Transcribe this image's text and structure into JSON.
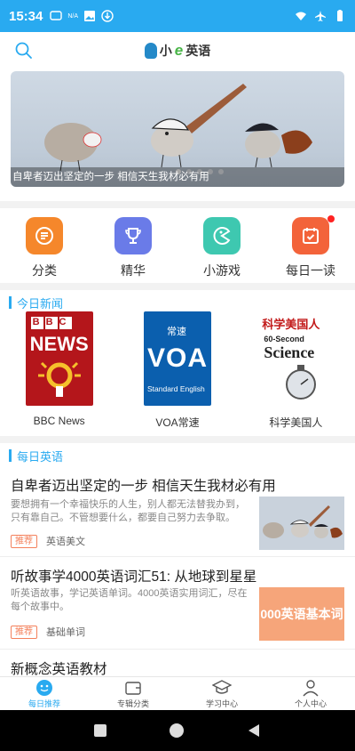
{
  "status_bar": {
    "time": "15:34",
    "na_label": "N/A"
  },
  "app": {
    "logo_text_1": "小",
    "logo_text_e": "e",
    "logo_text_2": "英语"
  },
  "banner": {
    "caption": "自卑者迈出坚定的一步 相信天生我材必有用",
    "slide_count": 5,
    "active_index": 0
  },
  "quick_menu": [
    {
      "label": "分类",
      "color": "#f5872b"
    },
    {
      "label": "精华",
      "color": "#6a7be8"
    },
    {
      "label": "小游戏",
      "color": "#3ec8b0"
    },
    {
      "label": "每日一读",
      "color": "#f3633a"
    }
  ],
  "news_section": {
    "title": "今日新闻",
    "items": [
      {
        "name": "BBC News",
        "cover_line1": "BBC",
        "cover_line2": "NEWS"
      },
      {
        "name": "VOA常速",
        "cover_top": "常速",
        "cover_main": "VOA",
        "cover_sub": "Standard English"
      },
      {
        "name": "科学美国人",
        "cover_top": "科学美国人",
        "cover_line1": "60-Second",
        "cover_line2": "Science"
      }
    ]
  },
  "daily_section": {
    "title": "每日英语",
    "articles": [
      {
        "title": "自卑者迈出坚定的一步 相信天生我材必有用",
        "desc": "要想拥有一个幸福快乐的人生，别人都无法替我办到，只有靠自己。不管想要什么，都要自己努力去争取。",
        "tag": "推荐",
        "category": "英语美文"
      },
      {
        "title": "听故事学4000英语词汇51: 从地球到星星",
        "desc": "听英语故事，学记英语单词。4000英语实用词汇，尽在每个故事中。",
        "tag": "推荐",
        "category": "基础单词",
        "thumb_text": "000英语基本词"
      },
      {
        "title": "新概念英语教材"
      }
    ]
  },
  "tab_bar": [
    {
      "label": "每日推荐",
      "active": true
    },
    {
      "label": "专辑分类",
      "active": false
    },
    {
      "label": "学习中心",
      "active": false
    },
    {
      "label": "个人中心",
      "active": false
    }
  ]
}
